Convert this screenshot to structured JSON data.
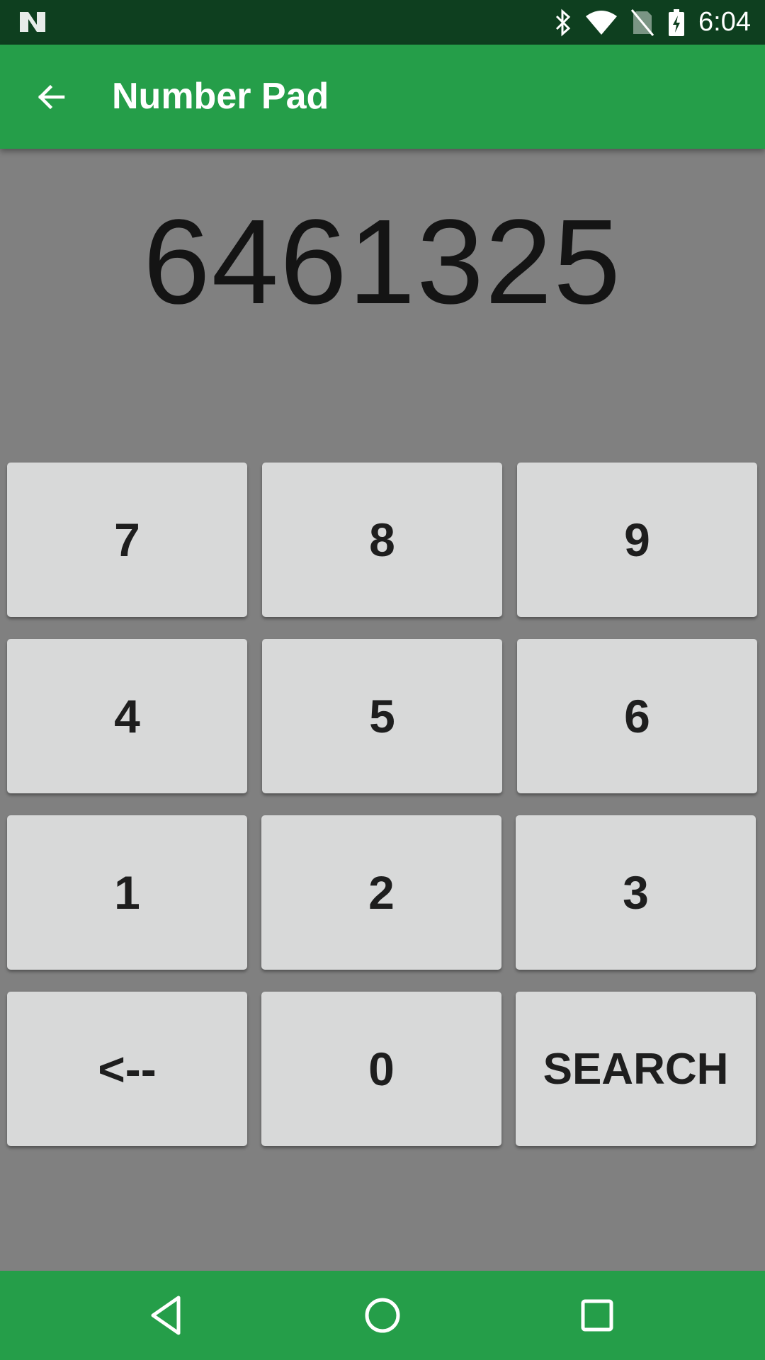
{
  "status_bar": {
    "time": "6:04",
    "icons": [
      "notification-n-icon",
      "bluetooth-icon",
      "wifi-icon",
      "no-sim-icon",
      "battery-charging-icon"
    ]
  },
  "app_bar": {
    "title": "Number Pad",
    "back_icon": "arrow-back-icon"
  },
  "display": {
    "value": "6461325"
  },
  "keypad": {
    "keys": [
      {
        "label": "7"
      },
      {
        "label": "8"
      },
      {
        "label": "9"
      },
      {
        "label": "4"
      },
      {
        "label": "5"
      },
      {
        "label": "6"
      },
      {
        "label": "1"
      },
      {
        "label": "2"
      },
      {
        "label": "3"
      },
      {
        "label": "<--"
      },
      {
        "label": "0"
      },
      {
        "label": "SEARCH"
      }
    ]
  },
  "nav_bar": {
    "icons": [
      "back-triangle-icon",
      "home-circle-icon",
      "recents-square-icon"
    ]
  },
  "colors": {
    "status_bar": "#0e3f1f",
    "primary": "#259e49",
    "background": "#808080",
    "key_bg": "#d8d9d9"
  }
}
